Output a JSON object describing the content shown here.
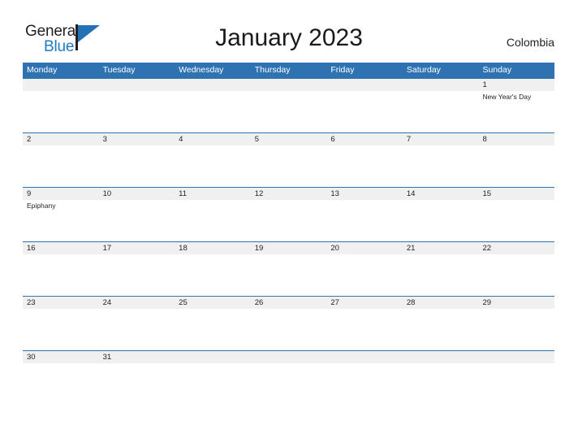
{
  "brand": {
    "name_part1": "General",
    "name_part2": "Blue",
    "flag_icon": "flag-icon"
  },
  "header": {
    "title": "January 2023",
    "country": "Colombia"
  },
  "colors": {
    "header_blue": "#2e72b2",
    "band_gray": "#f0f0f0",
    "logo_blue": "#1f7bc1",
    "text_dark": "#231f20"
  },
  "calendar": {
    "month": "January",
    "year": "2023",
    "weekday_headers": [
      "Monday",
      "Tuesday",
      "Wednesday",
      "Thursday",
      "Friday",
      "Saturday",
      "Sunday"
    ],
    "weeks": [
      {
        "days": [
          {
            "num": "",
            "events": []
          },
          {
            "num": "",
            "events": []
          },
          {
            "num": "",
            "events": []
          },
          {
            "num": "",
            "events": []
          },
          {
            "num": "",
            "events": []
          },
          {
            "num": "",
            "events": []
          },
          {
            "num": "1",
            "events": [
              "New Year's Day"
            ]
          }
        ]
      },
      {
        "days": [
          {
            "num": "2",
            "events": []
          },
          {
            "num": "3",
            "events": []
          },
          {
            "num": "4",
            "events": []
          },
          {
            "num": "5",
            "events": []
          },
          {
            "num": "6",
            "events": []
          },
          {
            "num": "7",
            "events": []
          },
          {
            "num": "8",
            "events": []
          }
        ]
      },
      {
        "days": [
          {
            "num": "9",
            "events": [
              "Epiphany"
            ]
          },
          {
            "num": "10",
            "events": []
          },
          {
            "num": "11",
            "events": []
          },
          {
            "num": "12",
            "events": []
          },
          {
            "num": "13",
            "events": []
          },
          {
            "num": "14",
            "events": []
          },
          {
            "num": "15",
            "events": []
          }
        ]
      },
      {
        "days": [
          {
            "num": "16",
            "events": []
          },
          {
            "num": "17",
            "events": []
          },
          {
            "num": "18",
            "events": []
          },
          {
            "num": "19",
            "events": []
          },
          {
            "num": "20",
            "events": []
          },
          {
            "num": "21",
            "events": []
          },
          {
            "num": "22",
            "events": []
          }
        ]
      },
      {
        "days": [
          {
            "num": "23",
            "events": []
          },
          {
            "num": "24",
            "events": []
          },
          {
            "num": "25",
            "events": []
          },
          {
            "num": "26",
            "events": []
          },
          {
            "num": "27",
            "events": []
          },
          {
            "num": "28",
            "events": []
          },
          {
            "num": "29",
            "events": []
          }
        ]
      },
      {
        "days": [
          {
            "num": "30",
            "events": []
          },
          {
            "num": "31",
            "events": []
          },
          {
            "num": "",
            "events": []
          },
          {
            "num": "",
            "events": []
          },
          {
            "num": "",
            "events": []
          },
          {
            "num": "",
            "events": []
          },
          {
            "num": "",
            "events": []
          }
        ]
      }
    ]
  }
}
